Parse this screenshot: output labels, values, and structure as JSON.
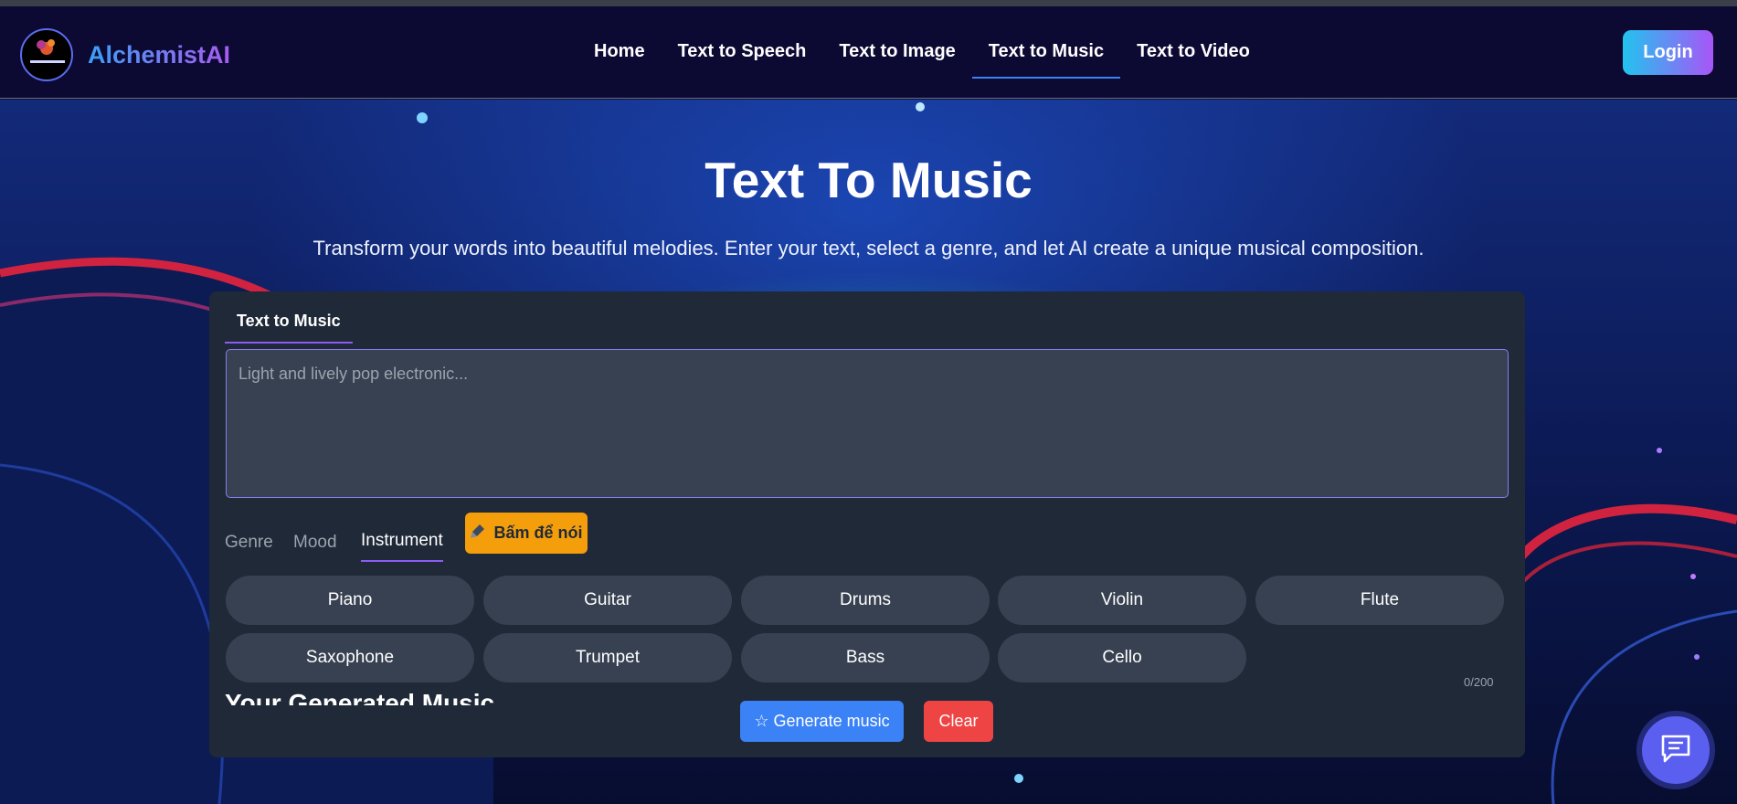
{
  "header": {
    "brand": "AlchemistAI",
    "nav": [
      {
        "label": "Home"
      },
      {
        "label": "Text to Speech"
      },
      {
        "label": "Text to Image"
      },
      {
        "label": "Text to Music",
        "active": true
      },
      {
        "label": "Text to Video"
      }
    ],
    "login_label": "Login"
  },
  "hero": {
    "title": "Text To Music",
    "subtitle": "Transform your words into beautiful melodies. Enter your text, select a genre, and let AI create a unique musical composition."
  },
  "card": {
    "tab_label": "Text to Music",
    "prompt_placeholder": "Light and lively pop electronic...",
    "prompt_value": "",
    "char_counter": "0/200",
    "option_tabs": [
      {
        "label": "Genre"
      },
      {
        "label": "Mood"
      },
      {
        "label": "Instrument",
        "active": true
      }
    ],
    "voice_button_label": "Bấm để nói",
    "instruments": [
      "Piano",
      "Guitar",
      "Drums",
      "Violin",
      "Flute",
      "Saxophone",
      "Trumpet",
      "Bass",
      "Cello"
    ],
    "generate_label": "☆ Generate music",
    "clear_label": "Clear"
  },
  "results": {
    "heading": "Your Generated Music"
  },
  "colors": {
    "navbar_bg": "#0c0933",
    "card_bg": "#1f2937",
    "chip_bg": "#374151",
    "accent_purple": "#8b5cf6",
    "generate_blue": "#3b82f6",
    "clear_red": "#ef4444",
    "mic_amber": "#f59e0b"
  },
  "icons": {
    "logo": "alchemist-logo-icon",
    "mic": "microphone-icon",
    "chat": "chat-bubble-icon"
  }
}
